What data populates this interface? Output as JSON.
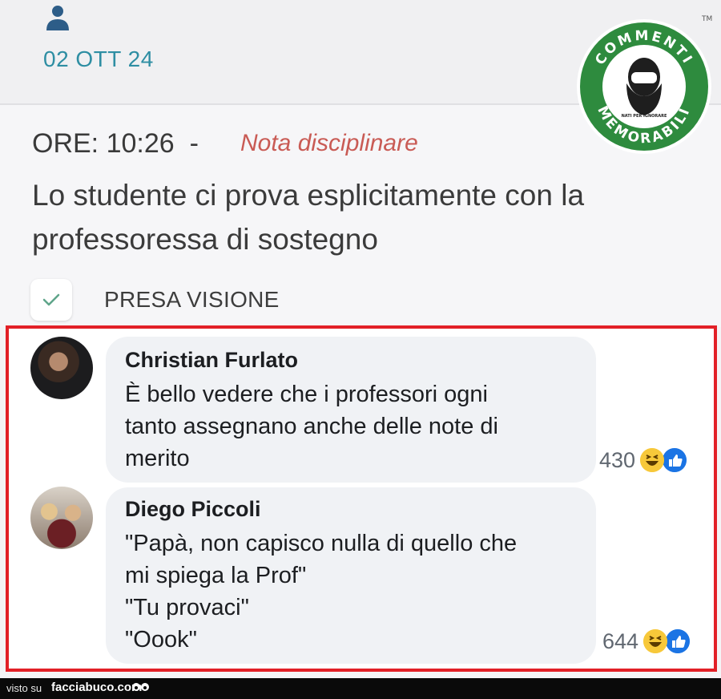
{
  "header": {
    "date": "02 OTT 24"
  },
  "note": {
    "time_label": "ORE: 10:26",
    "separator": "-",
    "type": "Nota disciplinare",
    "text": "Lo studente ci prova esplicitamente con la professoressa di sostegno",
    "acknowledge_label": "PRESA VISIONE"
  },
  "logo": {
    "top_text": "COMMENTI",
    "bottom_text": "MEMORABILI",
    "small_text": "NATI PER IGNORARE",
    "trademark": "TM",
    "color": "#2e8b3e"
  },
  "comments": [
    {
      "author": "Christian Furlato",
      "lines": [
        "È bello vedere che i professori ogni",
        "tanto assegnano anche delle note di",
        "merito"
      ],
      "reaction_count": "430"
    },
    {
      "author": "Diego Piccoli",
      "lines": [
        "\"Papà, non capisco nulla di quello che",
        "mi spiega la Prof\"",
        "\"Tu provaci\"",
        "\"Oook\""
      ],
      "reaction_count": "644"
    }
  ],
  "footer": {
    "prefix": "visto su",
    "site": "facciabuco.com"
  },
  "colors": {
    "accent_teal": "#2e8ea3",
    "note_red": "#c95b55",
    "frame_red": "#e22027",
    "like_blue": "#1b74e4"
  }
}
